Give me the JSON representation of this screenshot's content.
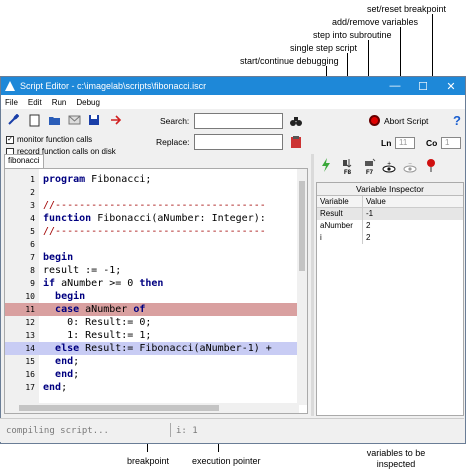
{
  "callouts": {
    "set_reset_breakpoint": "set/reset breakpoint",
    "add_remove_variables": "add/remove variables",
    "step_into_subroutine": "step into subroutine",
    "single_step_script": "single step script",
    "start_continue_debugging": "start/continue debugging",
    "breakpoint": "breakpoint",
    "execution_pointer": "execution pointer",
    "variables_inspected": "variables to be inspected"
  },
  "window": {
    "title": "Script Editor - c:\\imagelab\\scripts\\fibonacci.iscr",
    "controls": {
      "minimize": "—",
      "maximize": "☐",
      "close": "✕"
    }
  },
  "menu": {
    "file": "File",
    "edit": "Edit",
    "run": "Run",
    "debug": "Debug"
  },
  "toolbar": {
    "search_label": "Search:",
    "replace_label": "Replace:",
    "search_value": "",
    "replace_value": "",
    "monitor_label": "monitor function calls",
    "record_label": "record function calls on disk",
    "monitor_checked": true,
    "record_checked": false,
    "abort_label": "Abort Script",
    "help_glyph": "?",
    "ln_label": "Ln",
    "ln_value": "11",
    "co_label": "Co",
    "co_value": "1"
  },
  "debug_toolbar": {
    "f8": "F8",
    "f7": "F7"
  },
  "tab": {
    "label": "fibonacci"
  },
  "code": [
    {
      "n": "1",
      "text": "program Fibonacci;"
    },
    {
      "n": "2",
      "text": ""
    },
    {
      "n": "3",
      "text": "//-----------------------------------"
    },
    {
      "n": "4",
      "text": "function Fibonacci(aNumber: Integer):"
    },
    {
      "n": "5",
      "text": "//-----------------------------------"
    },
    {
      "n": "6",
      "text": ""
    },
    {
      "n": "7",
      "text": "begin"
    },
    {
      "n": "8",
      "text": "result := -1;"
    },
    {
      "n": "9",
      "text": "if aNumber >= 0 then"
    },
    {
      "n": "10",
      "text": "  begin"
    },
    {
      "n": "11",
      "text": "  case aNumber of"
    },
    {
      "n": "12",
      "text": "    0: Result:= 0;"
    },
    {
      "n": "13",
      "text": "    1: Result:= 1;"
    },
    {
      "n": "14",
      "text": "  else Result:= Fibonacci(aNumber-1) +"
    },
    {
      "n": "15",
      "text": "  end;"
    },
    {
      "n": "16",
      "text": "  end;"
    },
    {
      "n": "17",
      "text": "end;"
    }
  ],
  "inspector": {
    "title": "Variable Inspector",
    "headers": [
      "Variable",
      "Value"
    ],
    "rows": [
      [
        "Result",
        "-1"
      ],
      [
        "aNumber",
        "2"
      ],
      [
        "i",
        "2"
      ]
    ]
  },
  "status": {
    "left": "compiling script...",
    "right": "i: 1"
  },
  "colors": {
    "titlebar": "#1e88d8",
    "breakpoint_line": "#d9a0a0",
    "exec_line": "#c8ccf4",
    "abort_red": "#e00000"
  }
}
